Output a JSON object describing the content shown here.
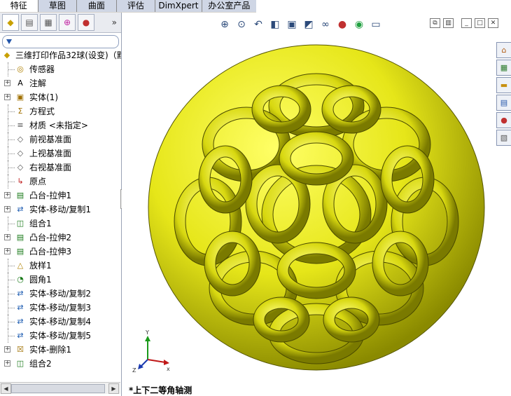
{
  "tabs": [
    "特征",
    "草图",
    "曲面",
    "评估",
    "DimXpert",
    "办公室产品"
  ],
  "feature_tree": {
    "root_label": "三维打印作品32球(设变)（默",
    "items": [
      {
        "label": "传感器",
        "icon": "sensor-icon",
        "expandable": false
      },
      {
        "label": "注解",
        "icon": "annotation-icon",
        "expandable": true
      },
      {
        "label": "实体(1)",
        "icon": "solid-body-icon",
        "expandable": true
      },
      {
        "label": "方程式",
        "icon": "equation-icon",
        "expandable": false
      },
      {
        "label": "材质 <未指定>",
        "icon": "material-icon",
        "expandable": false
      },
      {
        "label": "前视基准面",
        "icon": "plane-icon",
        "expandable": false
      },
      {
        "label": "上视基准面",
        "icon": "plane-icon",
        "expandable": false
      },
      {
        "label": "右视基准面",
        "icon": "plane-icon",
        "expandable": false
      },
      {
        "label": "原点",
        "icon": "origin-icon",
        "expandable": false
      },
      {
        "label": "凸台-拉伸1",
        "icon": "boss-extrude-icon",
        "expandable": true
      },
      {
        "label": "实体-移动/复制1",
        "icon": "move-copy-icon",
        "expandable": true
      },
      {
        "label": "组合1",
        "icon": "combine-icon",
        "expandable": false
      },
      {
        "label": "凸台-拉伸2",
        "icon": "boss-extrude-icon",
        "expandable": true
      },
      {
        "label": "凸台-拉伸3",
        "icon": "boss-extrude-icon",
        "expandable": true
      },
      {
        "label": "放样1",
        "icon": "loft-icon",
        "expandable": false
      },
      {
        "label": "圆角1",
        "icon": "fillet-icon",
        "expandable": false
      },
      {
        "label": "实体-移动/复制2",
        "icon": "move-copy-icon",
        "expandable": false
      },
      {
        "label": "实体-移动/复制3",
        "icon": "move-copy-icon",
        "expandable": false
      },
      {
        "label": "实体-移动/复制4",
        "icon": "move-copy-icon",
        "expandable": false
      },
      {
        "label": "实体-移动/复制5",
        "icon": "move-copy-icon",
        "expandable": false
      },
      {
        "label": "实体-删除1",
        "icon": "delete-body-icon",
        "expandable": true
      },
      {
        "label": "组合2",
        "icon": "combine-icon",
        "expandable": true
      }
    ]
  },
  "view": {
    "orientation_label": "*上下二等角轴测",
    "triad": {
      "x": "x",
      "y": "Y",
      "z": "Z"
    }
  },
  "colors": {
    "model": "#e6e619",
    "tab_bg": "#cfd6e5",
    "accent": "#2255aa"
  }
}
